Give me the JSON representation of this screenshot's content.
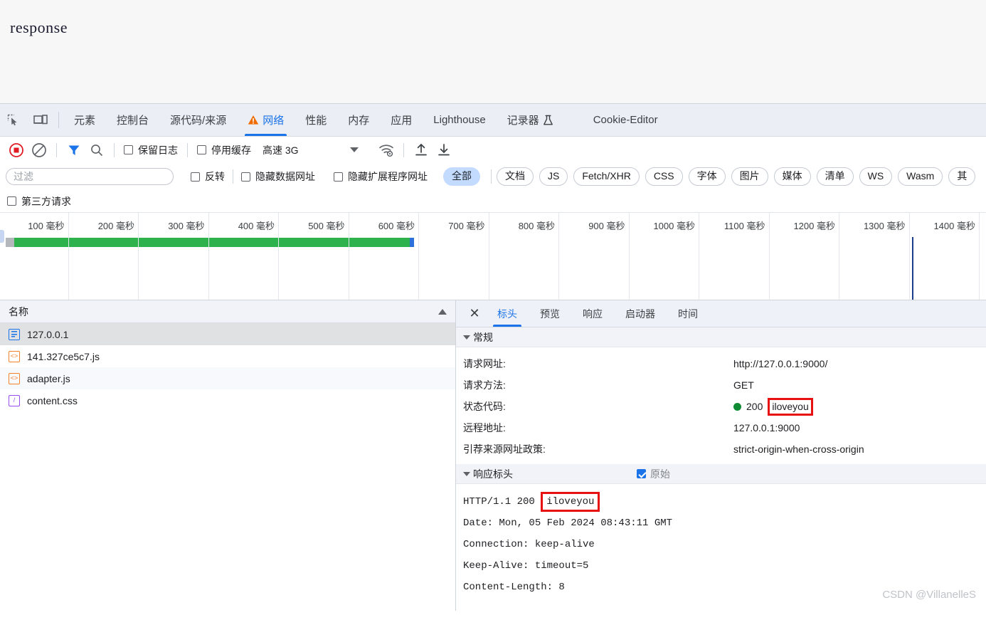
{
  "page": {
    "text": "response"
  },
  "devtools": {
    "icon_buttons": [
      {
        "name": "inspect-element-icon",
        "label": "inspect"
      },
      {
        "name": "device-toolbar-icon",
        "label": "device toolbar"
      }
    ],
    "tabs": [
      {
        "label": "元素",
        "active": false,
        "warn": false
      },
      {
        "label": "控制台",
        "active": false,
        "warn": false
      },
      {
        "label": "源代码/来源",
        "active": false,
        "warn": false
      },
      {
        "label": "网络",
        "active": true,
        "warn": true
      },
      {
        "label": "性能",
        "active": false,
        "warn": false
      },
      {
        "label": "内存",
        "active": false,
        "warn": false
      },
      {
        "label": "应用",
        "active": false,
        "warn": false
      },
      {
        "label": "Lighthouse",
        "active": false,
        "warn": false
      },
      {
        "label": "记录器",
        "active": false,
        "warn": false,
        "trailing_icon": "flask-icon"
      },
      {
        "label": "Cookie-Editor",
        "active": false,
        "warn": false
      }
    ]
  },
  "network_toolbar": {
    "record_button": "record-button",
    "clear_button": "clear-button",
    "filter_toggle": "filter-funnel-icon",
    "search_button": "search-icon",
    "preserve_log": {
      "label": "保留日志",
      "checked": false
    },
    "disable_cache": {
      "label": "停用缓存",
      "checked": false
    },
    "throttling": {
      "value": "高速 3G"
    },
    "network_conditions": "wifi-settings-icon",
    "import_har": "import-icon",
    "export_har": "export-icon"
  },
  "filter_bar": {
    "input_placeholder": "过滤",
    "input_value": "",
    "invert": {
      "label": "反转",
      "checked": false
    },
    "hide_data_urls": {
      "label": "隐藏数据网址",
      "checked": false
    },
    "hide_extension_urls": {
      "label": "隐藏扩展程序网址",
      "checked": false
    },
    "types": [
      {
        "label": "全部",
        "active": true
      },
      {
        "label": "文档",
        "active": false
      },
      {
        "label": "JS",
        "active": false
      },
      {
        "label": "Fetch/XHR",
        "active": false
      },
      {
        "label": "CSS",
        "active": false
      },
      {
        "label": "字体",
        "active": false
      },
      {
        "label": "图片",
        "active": false
      },
      {
        "label": "媒体",
        "active": false
      },
      {
        "label": "清单",
        "active": false
      },
      {
        "label": "WS",
        "active": false
      },
      {
        "label": "Wasm",
        "active": false
      },
      {
        "label": "其",
        "active": false
      }
    ],
    "third_party": {
      "label": "第三方请求",
      "checked": false
    }
  },
  "overview": {
    "ticks": [
      "100 毫秒",
      "200 毫秒",
      "300 毫秒",
      "400 毫秒",
      "500 毫秒",
      "600 毫秒",
      "700 毫秒",
      "800 毫秒",
      "900 毫秒",
      "1000 毫秒",
      "1100 毫秒",
      "1200 毫秒",
      "1300 毫秒",
      "1400 毫秒"
    ]
  },
  "request_list": {
    "column_header": "名称",
    "sort": "ascending",
    "rows": [
      {
        "name": "127.0.0.1",
        "type": "document",
        "selected": true
      },
      {
        "name": "141.327ce5c7.js",
        "type": "script",
        "selected": false
      },
      {
        "name": "adapter.js",
        "type": "script",
        "selected": false
      },
      {
        "name": "content.css",
        "type": "stylesheet",
        "selected": false
      }
    ]
  },
  "detail": {
    "close_label": "✕",
    "tabs": [
      {
        "label": "标头",
        "active": true
      },
      {
        "label": "预览",
        "active": false
      },
      {
        "label": "响应",
        "active": false
      },
      {
        "label": "启动器",
        "active": false
      },
      {
        "label": "时间",
        "active": false
      }
    ],
    "general": {
      "title": "常规",
      "rows": [
        {
          "key": "请求网址:",
          "value": "http://127.0.0.1:9000/"
        },
        {
          "key": "请求方法:",
          "value": "GET"
        },
        {
          "key": "状态代码:",
          "value": "200",
          "status_extra": "iloveyou",
          "dot": "#0f8b34"
        },
        {
          "key": "远程地址:",
          "value": "127.0.0.1:9000"
        },
        {
          "key": "引荐来源网址政策:",
          "value": "strict-origin-when-cross-origin"
        }
      ]
    },
    "response_headers": {
      "title": "响应标头",
      "raw_toggle": {
        "label": "原始",
        "checked": true
      },
      "lines": [
        {
          "text": "HTTP/1.1 200 ",
          "highlight": "iloveyou"
        },
        {
          "text": "Date: Mon, 05 Feb 2024 08:43:11 GMT"
        },
        {
          "text": "Connection: keep-alive"
        },
        {
          "text": "Keep-Alive: timeout=5"
        },
        {
          "text": "Content-Length: 8"
        }
      ]
    }
  },
  "watermark": "CSDN @VillanelleS",
  "colors": {
    "accent": "#1a73e8",
    "status_ok": "#0f8b34",
    "highlight_box": "#e81111",
    "timeline_bar": "#2eb24c"
  }
}
